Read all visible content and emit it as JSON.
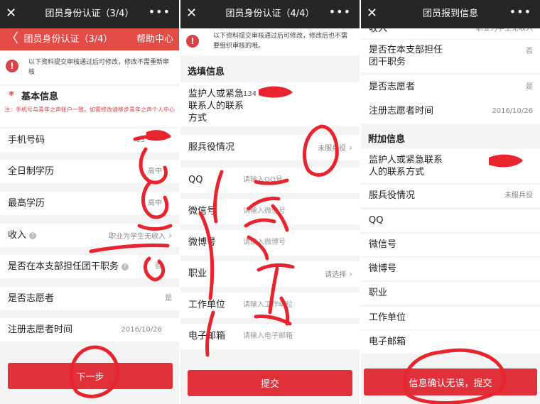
{
  "panel1": {
    "window_title": "团员身份认证（3/4）",
    "nav_title": "团员身份认证（3/4）",
    "help_label": "帮助中心",
    "notice": "以下资料提交审核通过后可修改，修改不需重新审核",
    "section_title": "基本信息",
    "section_note": "注：手机号与青年之声账户一致，如需修改请移步青年之声个人中心",
    "rows": [
      {
        "label": "手机号码",
        "value": "13"
      },
      {
        "label": "全日制学历",
        "value": "高中"
      },
      {
        "label": "最高学历",
        "value": "高中"
      },
      {
        "label": "收入",
        "value": "职业为学生无收入"
      },
      {
        "label": "是否在本支部担任团干职务",
        "value": "否"
      },
      {
        "label": "是否志愿者",
        "value": "是"
      },
      {
        "label": "注册志愿者时间",
        "value": "2016/10/26"
      }
    ],
    "button": "下一步"
  },
  "panel2": {
    "window_title": "团员身份认证（4/4）",
    "notice": "以下资料提交审核通过后可修改，修改后也不需要组织审核的哦。",
    "section_title": "选填信息",
    "rows": [
      {
        "label": "监护人或紧急联系人的联系方式",
        "value": "134"
      },
      {
        "label": "服兵役情况",
        "value": "未服兵役"
      },
      {
        "label": "QQ",
        "placeholder": "请输入QQ号"
      },
      {
        "label": "微信号",
        "placeholder": "请输入微信号"
      },
      {
        "label": "微博号",
        "placeholder": "请输入微博号"
      },
      {
        "label": "职业",
        "value": "请选择"
      },
      {
        "label": "工作单位",
        "placeholder": "请输入工作单位"
      },
      {
        "label": "电子邮箱",
        "placeholder": "请输入电子邮箱"
      }
    ],
    "button": "提交"
  },
  "panel3": {
    "window_title": "团员报到信息",
    "rows_top": [
      {
        "label": "收入",
        "value": "职业为学生无收入"
      },
      {
        "label": "是否在本支部担任团干职务",
        "value": "否"
      },
      {
        "label": "是否志愿者",
        "value": "是"
      },
      {
        "label": "注册志愿者时间",
        "value": "2016/10/26"
      }
    ],
    "section_title": "附加信息",
    "rows_bottom": [
      {
        "label": "监护人或紧急联系人的联系方式",
        "value": "1"
      },
      {
        "label": "服兵役情况",
        "value": "未服兵役"
      },
      {
        "label": "QQ"
      },
      {
        "label": "微信号"
      },
      {
        "label": "微博号"
      },
      {
        "label": "职业"
      },
      {
        "label": "工作单位"
      },
      {
        "label": "电子邮箱"
      }
    ],
    "button": "信息确认无误，提交"
  },
  "icons": {
    "close": "✕",
    "more": "•••",
    "back": "〈",
    "warning": "!",
    "chevron": "›",
    "help": "?",
    "required": "*"
  },
  "colors": {
    "accent": "#e24b46",
    "button": "#e0303a",
    "topbar": "#262626",
    "annotation": "#e8242e"
  }
}
